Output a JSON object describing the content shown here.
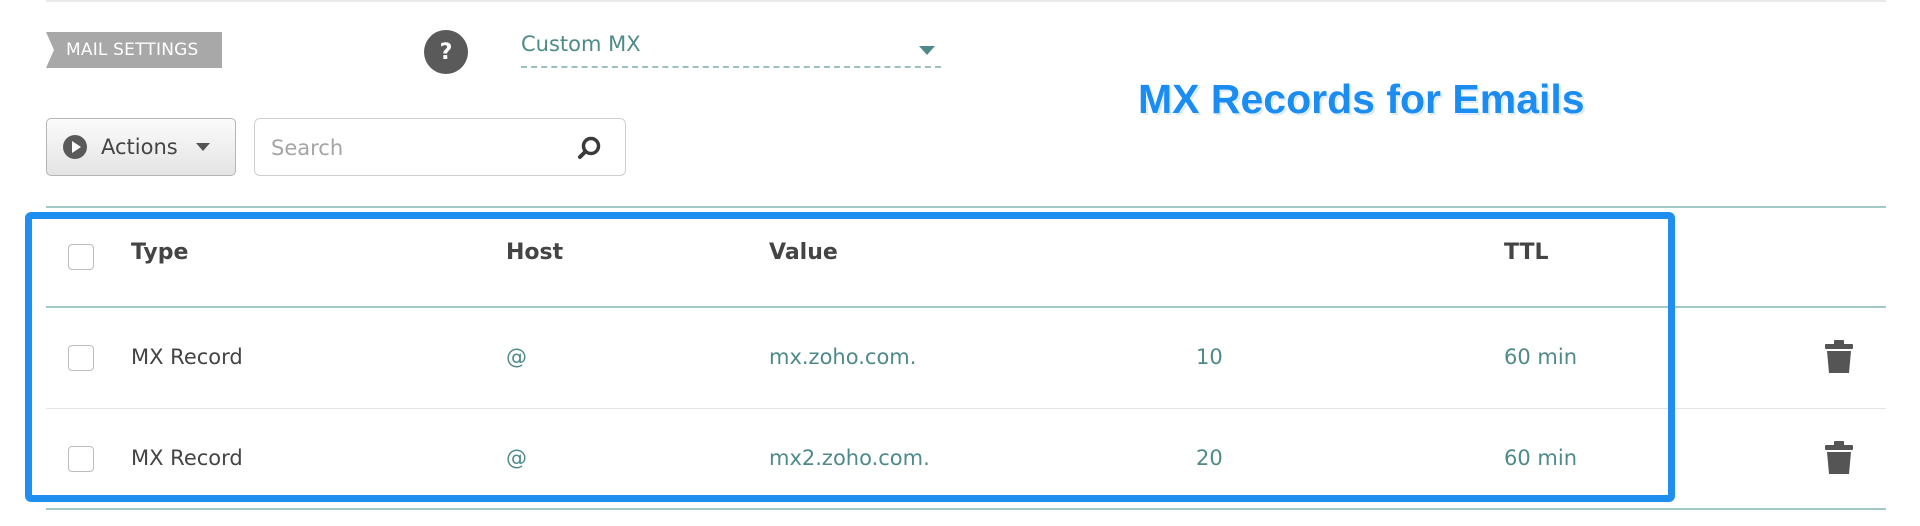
{
  "mail_settings": {
    "tag_label": "MAIL SETTINGS",
    "help_label": "?",
    "selected_mode": "Custom MX"
  },
  "annotation": {
    "text": "MX Records for Emails",
    "color": "#1a8cf2"
  },
  "toolbar": {
    "actions_label": "Actions",
    "search_placeholder": "Search",
    "search_value": ""
  },
  "table": {
    "headers": {
      "type": "Type",
      "host": "Host",
      "value": "Value",
      "ttl": "TTL"
    },
    "rows": [
      {
        "type": "MX Record",
        "host": "@",
        "value": "mx.zoho.com.",
        "priority": "10",
        "ttl": "60 min"
      },
      {
        "type": "MX Record",
        "host": "@",
        "value": "mx2.zoho.com.",
        "priority": "20",
        "ttl": "60 min"
      }
    ]
  },
  "icons": {
    "help": "question-icon",
    "actions": "play-icon",
    "search": "search-icon",
    "delete": "trash-icon"
  },
  "colors": {
    "accent_teal": "#4f8a8a",
    "highlight_blue": "#1e8ff0",
    "tag_gray": "#a8a8a8"
  }
}
